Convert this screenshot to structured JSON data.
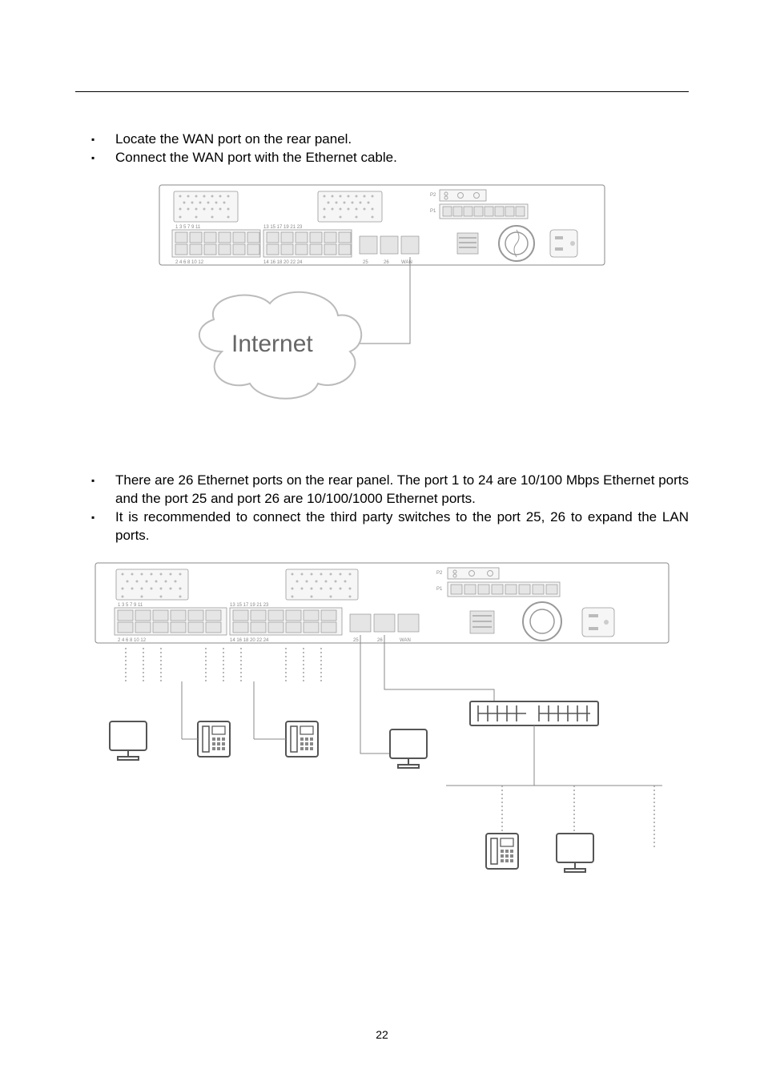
{
  "section1": {
    "bullets": [
      "Locate the WAN port on the rear panel.",
      "Connect the WAN port with the Ethernet cable."
    ],
    "diagram": {
      "cloud_label": "Internet",
      "psu_labels": {
        "p1": "P1",
        "p2": "P2"
      },
      "wan_label": "WAN"
    }
  },
  "section2": {
    "bullets": [
      "There are 26 Ethernet ports on the rear panel. The port 1 to 24 are 10/100 Mbps Ethernet ports and the port 25 and port 26 are 10/100/1000 Ethernet ports.",
      "It is recommended to connect the third party switches to the port 25, 26 to expand the LAN ports."
    ],
    "diagram": {
      "psu_labels": {
        "p1": "P1",
        "p2": "P2"
      },
      "wan_label": "WAN"
    }
  },
  "page_number": "22"
}
